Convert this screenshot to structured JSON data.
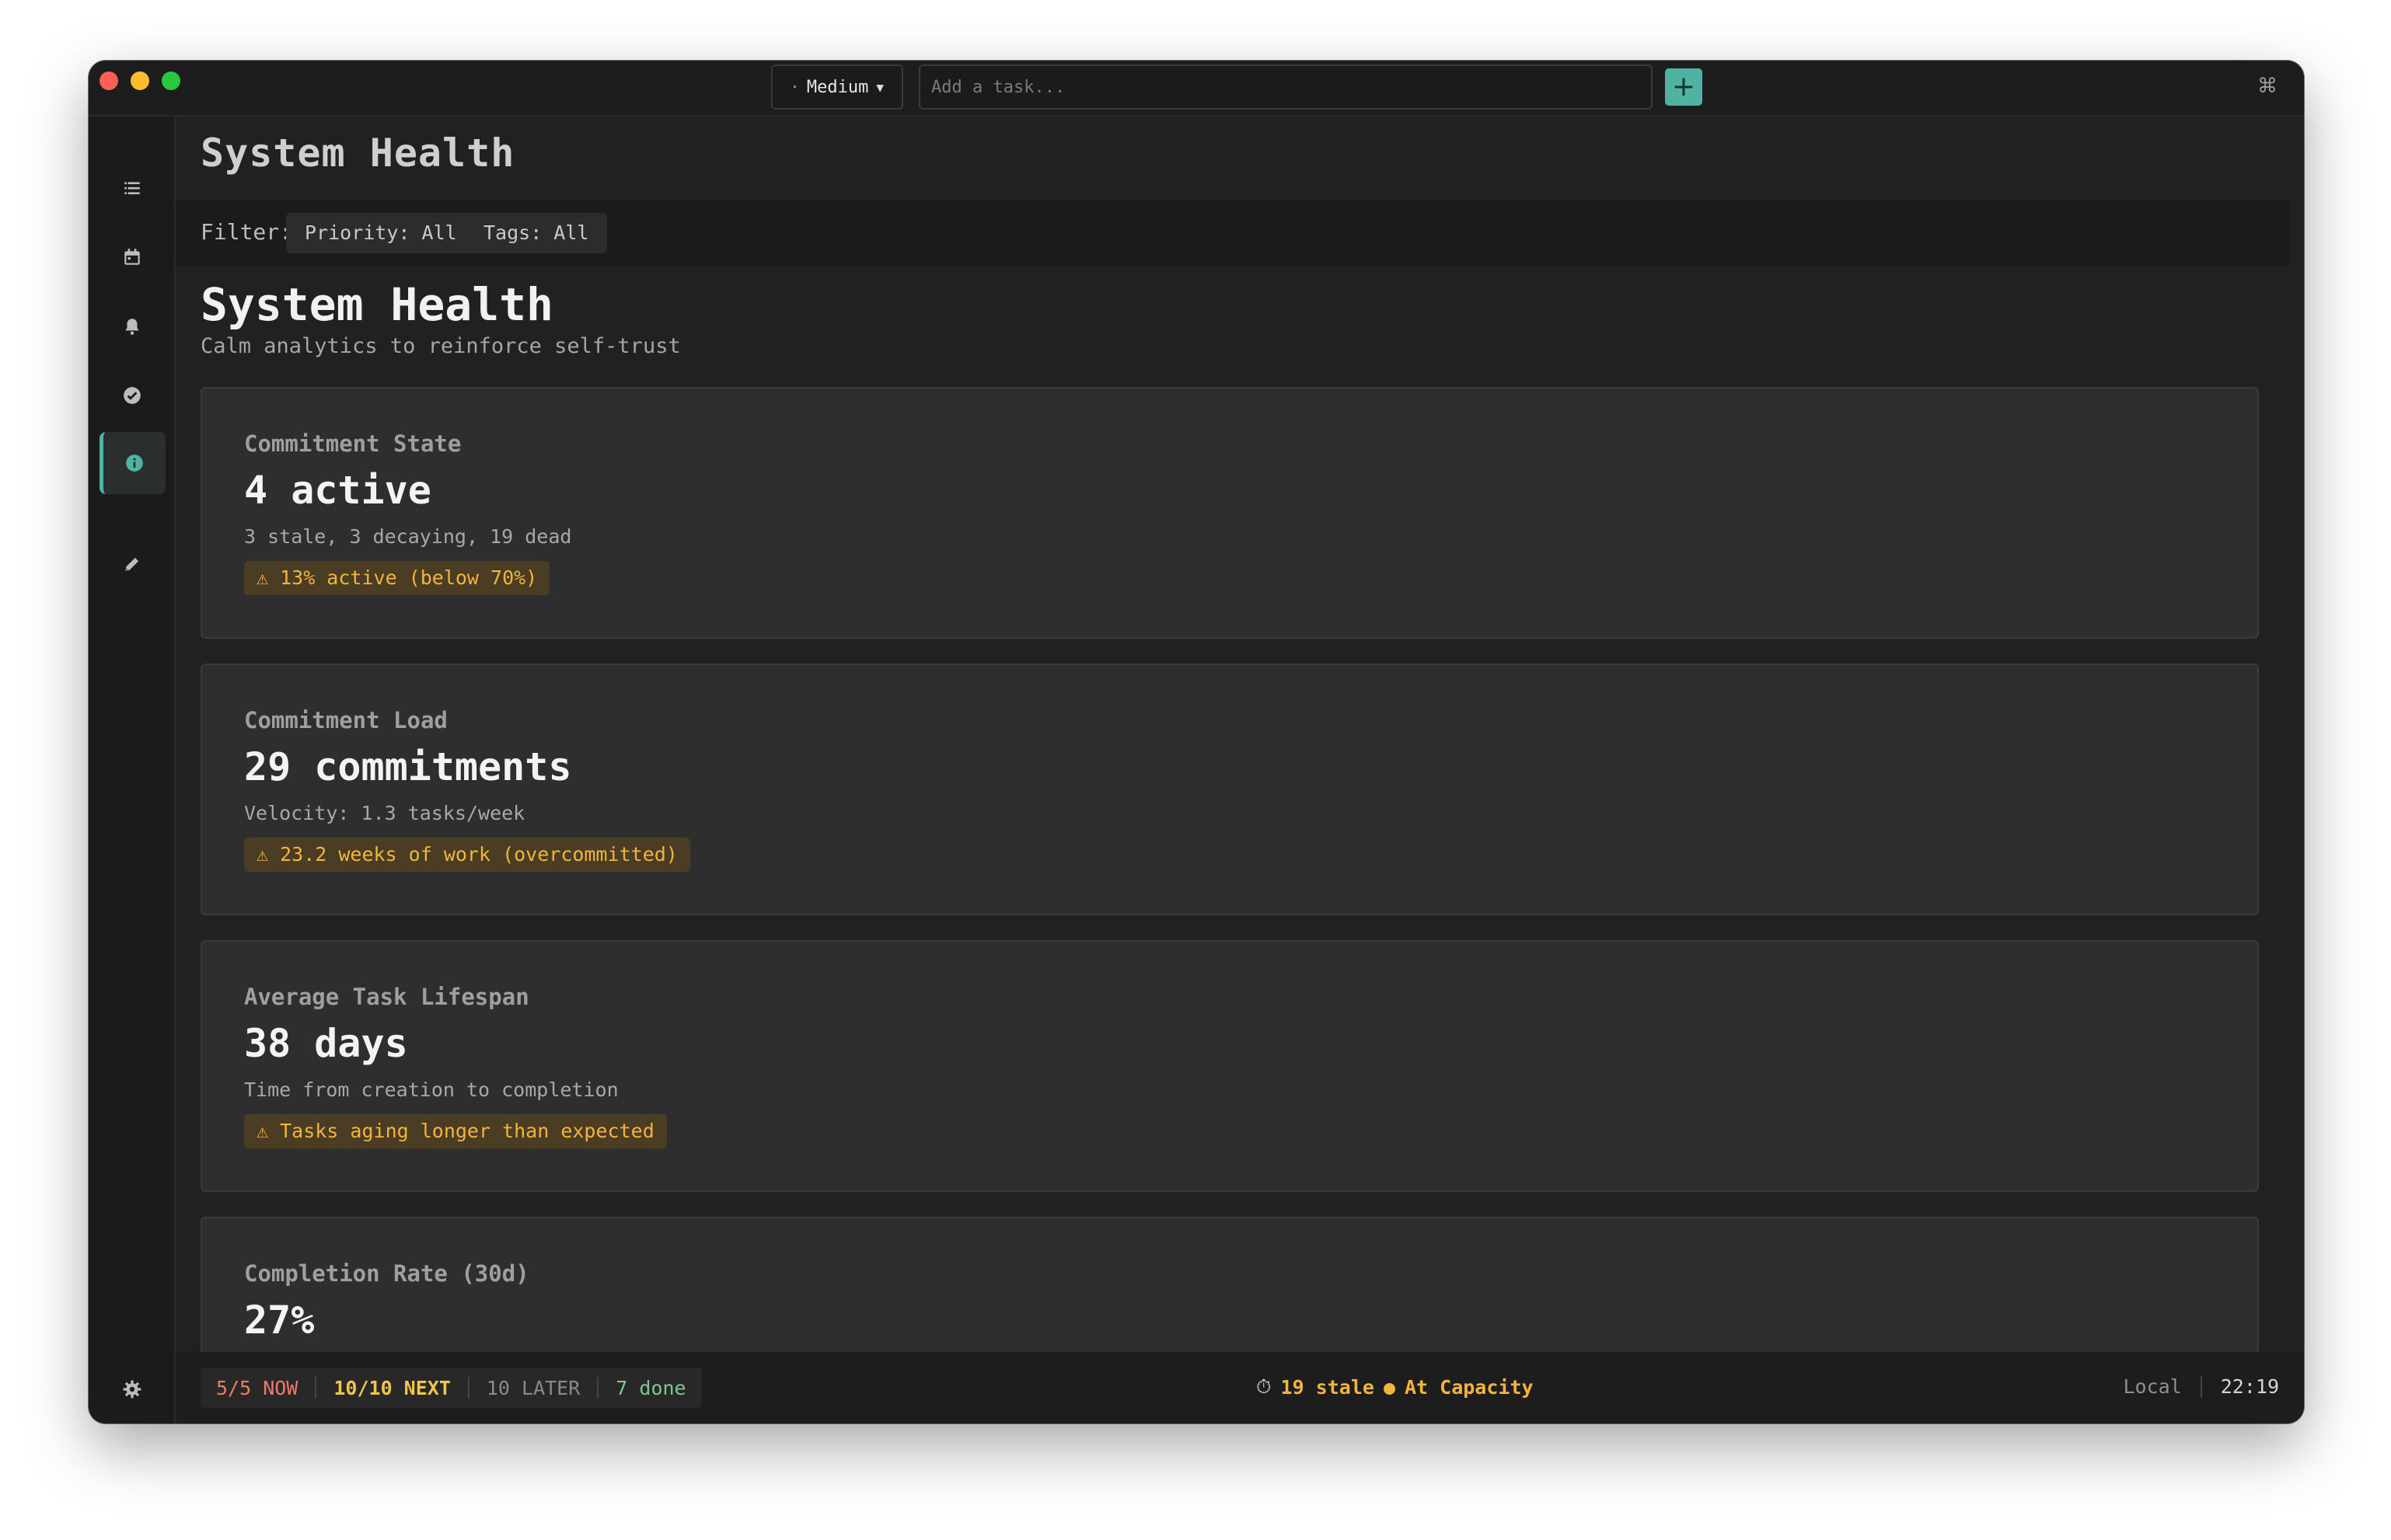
{
  "toolbar": {
    "priority_value": "Medium",
    "task_placeholder": "Add a task...",
    "add_label": "+",
    "cmd_label": "⌘"
  },
  "sidebar": {
    "items": [
      {
        "name": "list",
        "icon": "list-icon"
      },
      {
        "name": "calendar",
        "icon": "calendar-icon"
      },
      {
        "name": "notifications",
        "icon": "bell-icon"
      },
      {
        "name": "completed",
        "icon": "check-circle-icon"
      },
      {
        "name": "system-health",
        "icon": "info-icon",
        "active": true
      },
      {
        "name": "edit",
        "icon": "pencil-icon"
      },
      {
        "name": "settings",
        "icon": "gear-icon"
      }
    ]
  },
  "header": {
    "title": "System Health"
  },
  "filter": {
    "label": "Filter:",
    "priority": "Priority: All",
    "tags": "Tags: All"
  },
  "page": {
    "title": "System Health",
    "subtitle": "Calm analytics to reinforce self-trust"
  },
  "cards": [
    {
      "label": "Commitment State",
      "value": "4 active",
      "detail": "3 stale, 3 decaying, 19 dead",
      "warning": "⚠ 13% active (below 70%)"
    },
    {
      "label": "Commitment Load",
      "value": "29 commitments",
      "detail": "Velocity: 1.3 tasks/week",
      "warning": "⚠ 23.2 weeks of work (overcommitted)"
    },
    {
      "label": "Average Task Lifespan",
      "value": "38 days",
      "detail": "Time from creation to completion",
      "warning": "⚠ Tasks aging longer than expected"
    },
    {
      "label": "Completion Rate (30d)",
      "value": "27%"
    }
  ],
  "status": {
    "now": "5/5 NOW",
    "next": "10/10 NEXT",
    "later": "10 LATER",
    "done": "7 done",
    "stale": "19 stale",
    "capacity": "At Capacity",
    "location": "Local",
    "time": "22:19"
  },
  "colors": {
    "accent": "#4fb3a3",
    "warning": "#f2b43c",
    "now": "#f07a6a",
    "done": "#7cc98e"
  }
}
